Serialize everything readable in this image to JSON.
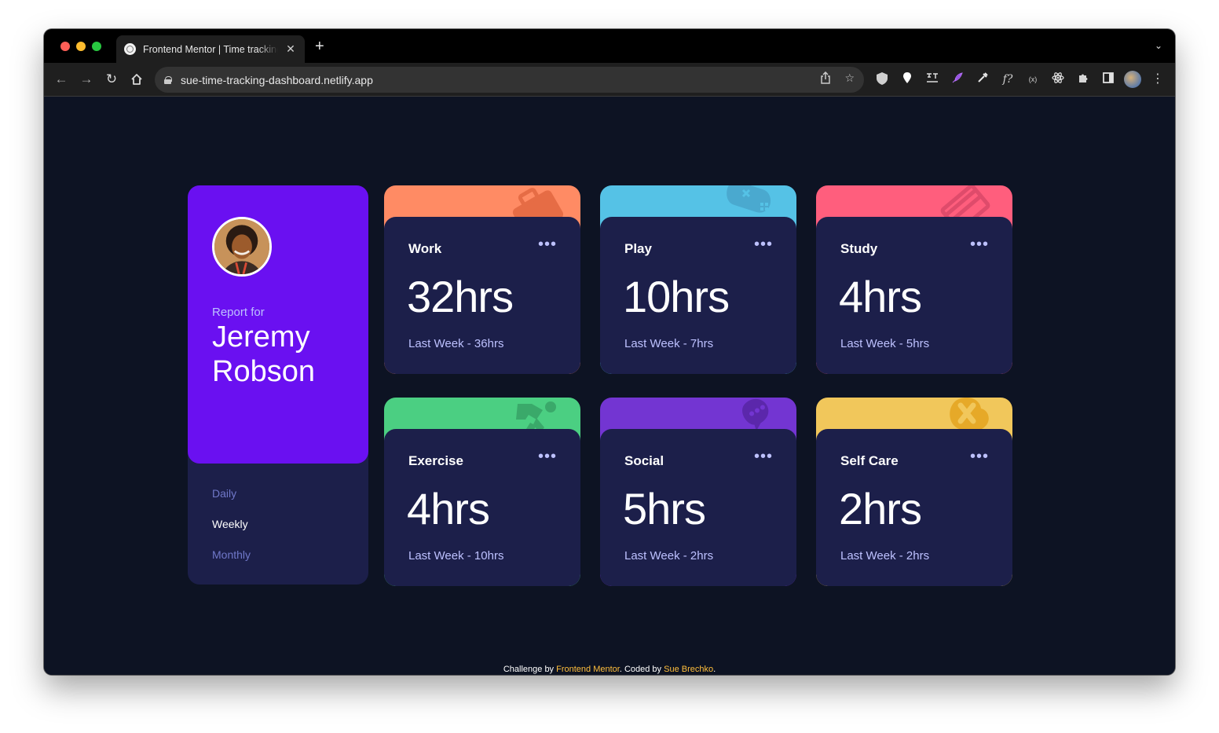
{
  "browser": {
    "tab_title": "Frontend Mentor | Time tracking dashboard",
    "tab_close": "✕",
    "new_tab": "+",
    "url": "sue-time-tracking-dashboard.netlify.app"
  },
  "profile": {
    "report_for": "Report for",
    "name": "Jeremy Robson",
    "periods": [
      "Daily",
      "Weekly",
      "Monthly"
    ],
    "active_period": "Weekly"
  },
  "cards": [
    {
      "title": "Work",
      "current": "32hrs",
      "previous": "Last Week - 36hrs",
      "color": "#ff8b64",
      "icon": "briefcase-icon"
    },
    {
      "title": "Play",
      "current": "10hrs",
      "previous": "Last Week - 7hrs",
      "color": "#55c2e6",
      "icon": "gamepad-icon"
    },
    {
      "title": "Study",
      "current": "4hrs",
      "previous": "Last Week - 5hrs",
      "color": "#ff5e7d",
      "icon": "book-icon"
    },
    {
      "title": "Exercise",
      "current": "4hrs",
      "previous": "Last Week - 10hrs",
      "color": "#4bcf82",
      "icon": "runner-icon"
    },
    {
      "title": "Social",
      "current": "5hrs",
      "previous": "Last Week - 2hrs",
      "color": "#7335d2",
      "icon": "social-icon"
    },
    {
      "title": "Self Care",
      "current": "2hrs",
      "previous": "Last Week - 2hrs",
      "color": "#f1c75b",
      "icon": "bandage-icon"
    }
  ],
  "card_menu": "•••",
  "footer": {
    "prefix": "Challenge by ",
    "challenge_link": "Frontend Mentor",
    "middle": ". Coded by ",
    "author_link": "Sue Brechko",
    "suffix": "."
  }
}
